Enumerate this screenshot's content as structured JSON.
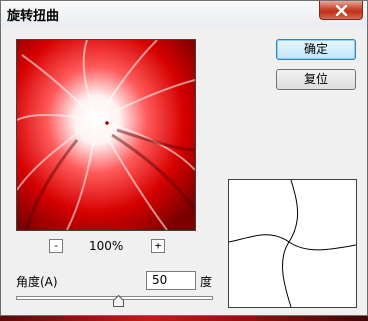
{
  "window": {
    "title": "旋转扭曲"
  },
  "buttons": {
    "ok": "确定",
    "reset": "复位"
  },
  "zoom": {
    "minus": "-",
    "value": "100%",
    "plus": "+"
  },
  "angle": {
    "label": "角度(A)",
    "value": "50",
    "unit": "度",
    "slider_fraction": 0.525
  },
  "icons": {
    "close": "close-icon",
    "thumb": "slider-thumb-icon"
  }
}
